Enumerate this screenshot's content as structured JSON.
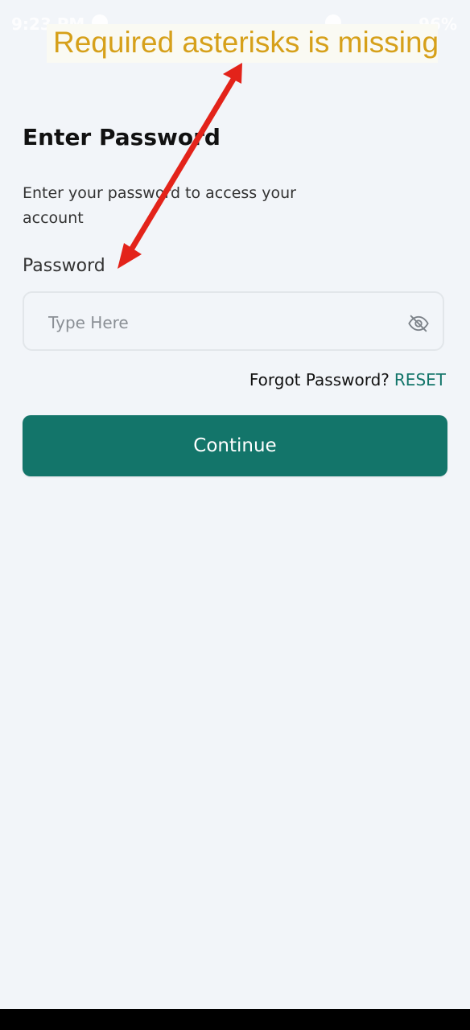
{
  "status_bar": {
    "time": "9:23 PM",
    "battery": "96%"
  },
  "annotation": {
    "text": "Required asterisks is missing",
    "text_color": "#d6a01a",
    "arrow_color": "#e3231a"
  },
  "main": {
    "title": "Enter Password",
    "subtitle": "Enter your password to access your account",
    "field_label": "Password",
    "input_value": "",
    "input_placeholder": "Type Here",
    "forgot_text": "Forgot Password?",
    "reset_label": "RESET",
    "continue_label": "Continue"
  },
  "icons": {
    "visibility_toggle": "eye-off-icon"
  },
  "colors": {
    "accent": "#13756a",
    "background": "#f2f5f9"
  }
}
